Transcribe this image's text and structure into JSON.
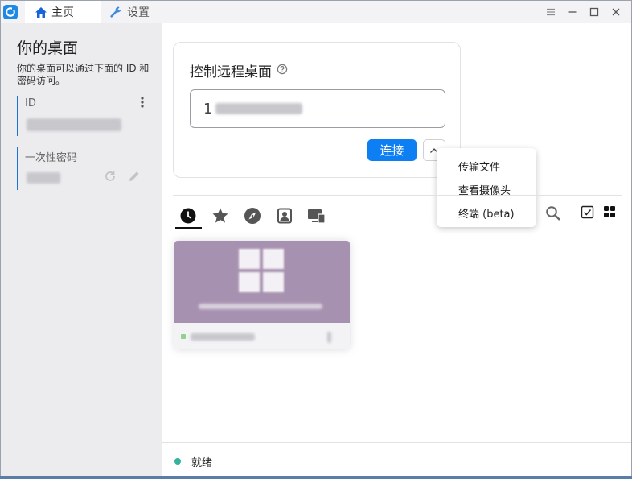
{
  "titlebar": {
    "tabs": [
      {
        "label": "主页",
        "icon": "home-icon",
        "active": true
      },
      {
        "label": "设置",
        "icon": "wrench-icon",
        "active": false
      }
    ],
    "window_buttons": [
      "menu-icon",
      "minimize-icon",
      "maximize-icon",
      "close-icon"
    ]
  },
  "sidebar": {
    "title": "你的桌面",
    "description": "你的桌面可以通过下面的 ID 和密码访问。",
    "id_label": "ID",
    "password_label": "一次性密码"
  },
  "connect": {
    "title": "控制远程桌面",
    "input_value": "1",
    "connect_label": "连接"
  },
  "dropdown": {
    "items": [
      "传输文件",
      "查看摄像头",
      "终端 (beta)"
    ]
  },
  "peer_tabs": [
    "recent-icon",
    "star-icon",
    "compass-icon",
    "address-book-icon",
    "devices-icon"
  ],
  "status": {
    "text": "就绪",
    "color": "#33b39e"
  },
  "colors": {
    "accent": "#0d7ff2",
    "sidebar_bg": "#ececef",
    "thumb_bg": "#a791b0"
  }
}
